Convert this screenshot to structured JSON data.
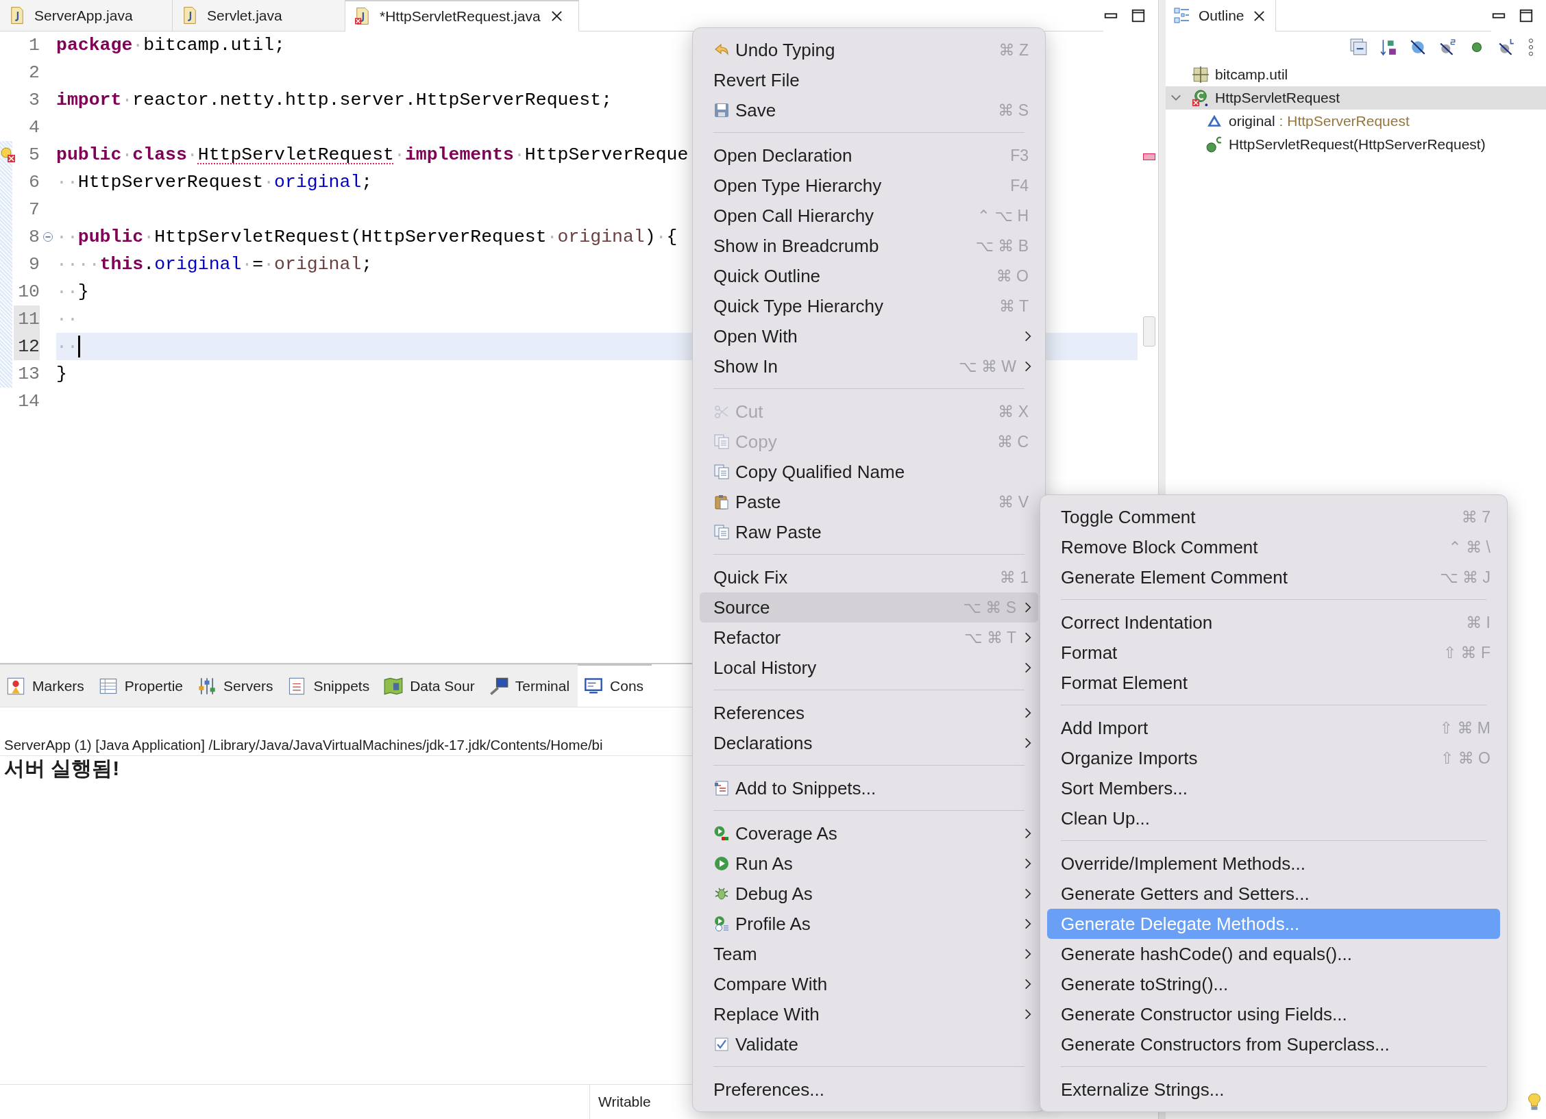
{
  "editor": {
    "tabs": [
      {
        "label": "ServerApp.java",
        "selected": false,
        "error": false
      },
      {
        "label": "Servlet.java",
        "selected": false,
        "error": false
      },
      {
        "label": "*HttpServletRequest.java",
        "selected": true,
        "error": true
      }
    ],
    "lines": [
      {
        "number": "1",
        "current": false,
        "changed": false,
        "problem": false,
        "fold": false,
        "tokens": [
          {
            "text": "package",
            "kind": "kw"
          },
          {
            "text": "·",
            "kind": "ws"
          },
          {
            "text": "bitcamp.util;",
            "kind": "plain"
          }
        ]
      },
      {
        "number": "2",
        "current": false,
        "changed": false,
        "problem": false,
        "fold": false
      },
      {
        "number": "3",
        "current": false,
        "changed": false,
        "problem": false,
        "fold": false,
        "tokens": [
          {
            "text": "import",
            "kind": "kw"
          },
          {
            "text": "·",
            "kind": "ws"
          },
          {
            "text": "reactor.netty.http.server.HttpServerRequest;",
            "kind": "plain"
          }
        ]
      },
      {
        "number": "4",
        "current": false,
        "changed": false,
        "problem": false,
        "fold": false
      },
      {
        "number": "5",
        "current": false,
        "changed": false,
        "problem": true,
        "fold": false,
        "tokens": [
          {
            "text": "public",
            "kind": "kw"
          },
          {
            "text": "·",
            "kind": "ws"
          },
          {
            "text": "class",
            "kind": "kw"
          },
          {
            "text": "·",
            "kind": "ws"
          },
          {
            "text": "HttpServletRequest",
            "kind": "error"
          },
          {
            "text": "·",
            "kind": "ws"
          },
          {
            "text": "implements",
            "kind": "kw"
          },
          {
            "text": "·",
            "kind": "ws"
          },
          {
            "text": "HttpServerReque",
            "kind": "plain"
          }
        ]
      },
      {
        "number": "6",
        "current": false,
        "changed": false,
        "problem": false,
        "fold": false,
        "tokens": [
          {
            "text": "··",
            "kind": "ws"
          },
          {
            "text": "HttpServerRequest",
            "kind": "plain"
          },
          {
            "text": "·",
            "kind": "ws"
          },
          {
            "text": "original",
            "kind": "field"
          },
          {
            "text": ";",
            "kind": "plain"
          }
        ]
      },
      {
        "number": "7",
        "current": false,
        "changed": false,
        "problem": false,
        "fold": false
      },
      {
        "number": "8",
        "current": false,
        "changed": false,
        "problem": false,
        "fold": true,
        "tokens": [
          {
            "text": "··",
            "kind": "ws"
          },
          {
            "text": "public",
            "kind": "kw"
          },
          {
            "text": "·",
            "kind": "ws"
          },
          {
            "text": "HttpServletRequest(HttpServerRequest",
            "kind": "plain"
          },
          {
            "text": "·",
            "kind": "ws"
          },
          {
            "text": "original",
            "kind": "param"
          },
          {
            "text": ")",
            "kind": "plain"
          },
          {
            "text": "·",
            "kind": "ws"
          },
          {
            "text": "{",
            "kind": "plain"
          }
        ]
      },
      {
        "number": "9",
        "current": false,
        "changed": false,
        "problem": false,
        "fold": false,
        "tokens": [
          {
            "text": "····",
            "kind": "ws"
          },
          {
            "text": "this",
            "kind": "kw"
          },
          {
            "text": ".",
            "kind": "plain"
          },
          {
            "text": "original",
            "kind": "field"
          },
          {
            "text": "·",
            "kind": "ws"
          },
          {
            "text": "=",
            "kind": "plain"
          },
          {
            "text": "·",
            "kind": "ws"
          },
          {
            "text": "original",
            "kind": "param"
          },
          {
            "text": ";",
            "kind": "plain"
          }
        ]
      },
      {
        "number": "10",
        "current": false,
        "changed": false,
        "problem": false,
        "fold": false,
        "tokens": [
          {
            "text": "··",
            "kind": "ws"
          },
          {
            "text": "}",
            "kind": "plain"
          }
        ]
      },
      {
        "number": "11",
        "current": false,
        "changed": true,
        "problem": false,
        "fold": false,
        "tokens": [
          {
            "text": "··",
            "kind": "ws"
          }
        ]
      },
      {
        "number": "12",
        "current": true,
        "changed": true,
        "problem": false,
        "fold": false,
        "tokens": [
          {
            "text": "··",
            "kind": "ws"
          }
        ]
      },
      {
        "number": "13",
        "current": false,
        "changed": false,
        "problem": false,
        "fold": false,
        "tokens": [
          {
            "text": "}",
            "kind": "plain"
          }
        ]
      },
      {
        "number": "14",
        "current": false,
        "changed": false,
        "problem": false,
        "fold": false
      }
    ]
  },
  "bottom_panel": {
    "tabs": [
      {
        "label": "Markers",
        "selected": false
      },
      {
        "label": "Propertie",
        "selected": false
      },
      {
        "label": "Servers",
        "selected": false
      },
      {
        "label": "Snippets",
        "selected": false
      },
      {
        "label": "Data Sour",
        "selected": false
      },
      {
        "label": "Terminal",
        "selected": false
      },
      {
        "label": "Cons",
        "selected": true
      }
    ],
    "console_header": "ServerApp (1) [Java Application] /Library/Java/JavaVirtualMachines/jdk-17.jdk/Contents/Home/bi",
    "output": [
      "서버 실행됨!"
    ]
  },
  "status_bar": {
    "mode": "Writable"
  },
  "outline": {
    "title": "Outline",
    "items": [
      {
        "label": "bitcamp.util",
        "kind": "package",
        "selected": false
      },
      {
        "label": "HttpServletRequest",
        "kind": "class",
        "selected": true,
        "expanded": true,
        "children": [
          {
            "label": "original",
            "type": ": HttpServerRequest",
            "kind": "field",
            "selected": false
          },
          {
            "label": "HttpServletRequest(HttpServerRequest)",
            "kind": "constructor",
            "selected": false
          }
        ]
      }
    ]
  },
  "context_menu": {
    "groups": [
      {
        "items": [
          {
            "label": "Undo Typing",
            "shortcut": "⌘ Z",
            "submenu": false,
            "disabled": false,
            "selected": false
          },
          {
            "label": "Revert File",
            "submenu": false,
            "disabled": false,
            "selected": false
          },
          {
            "label": "Save",
            "shortcut": "⌘ S",
            "submenu": false,
            "disabled": false,
            "selected": false
          }
        ]
      },
      {
        "items": [
          {
            "label": "Open Declaration",
            "shortcut": "F3",
            "submenu": false,
            "disabled": false,
            "selected": false
          },
          {
            "label": "Open Type Hierarchy",
            "shortcut": "F4",
            "submenu": false,
            "disabled": false,
            "selected": false
          },
          {
            "label": "Open Call Hierarchy",
            "shortcut": "⌃ ⌥ H",
            "submenu": false,
            "disabled": false,
            "selected": false
          },
          {
            "label": "Show in Breadcrumb",
            "shortcut": "⌥ ⌘ B",
            "submenu": false,
            "disabled": false,
            "selected": false
          },
          {
            "label": "Quick Outline",
            "shortcut": "⌘ O",
            "submenu": false,
            "disabled": false,
            "selected": false
          },
          {
            "label": "Quick Type Hierarchy",
            "shortcut": "⌘ T",
            "submenu": false,
            "disabled": false,
            "selected": false
          },
          {
            "label": "Open With",
            "submenu": true,
            "disabled": false,
            "selected": false
          },
          {
            "label": "Show In",
            "shortcut": "⌥ ⌘ W",
            "submenu": true,
            "disabled": false,
            "selected": false
          }
        ]
      },
      {
        "items": [
          {
            "label": "Cut",
            "shortcut": "⌘ X",
            "submenu": false,
            "disabled": true,
            "selected": false
          },
          {
            "label": "Copy",
            "shortcut": "⌘ C",
            "submenu": false,
            "disabled": true,
            "selected": false
          },
          {
            "label": "Copy Qualified Name",
            "submenu": false,
            "disabled": false,
            "selected": false
          },
          {
            "label": "Paste",
            "shortcut": "⌘ V",
            "submenu": false,
            "disabled": false,
            "selected": false
          },
          {
            "label": "Raw Paste",
            "submenu": false,
            "disabled": false,
            "selected": false
          }
        ]
      },
      {
        "items": [
          {
            "label": "Quick Fix",
            "shortcut": "⌘ 1",
            "submenu": false,
            "disabled": false,
            "selected": false
          },
          {
            "label": "Source",
            "shortcut": "⌥ ⌘ S",
            "submenu": true,
            "disabled": false,
            "selected": true
          },
          {
            "label": "Refactor",
            "shortcut": "⌥ ⌘ T",
            "submenu": true,
            "disabled": false,
            "selected": false
          },
          {
            "label": "Local History",
            "submenu": true,
            "disabled": false,
            "selected": false
          }
        ]
      },
      {
        "items": [
          {
            "label": "References",
            "submenu": true,
            "disabled": false,
            "selected": false
          },
          {
            "label": "Declarations",
            "submenu": true,
            "disabled": false,
            "selected": false
          }
        ]
      },
      {
        "items": [
          {
            "label": "Add to Snippets...",
            "submenu": false,
            "disabled": false,
            "selected": false
          }
        ]
      },
      {
        "items": [
          {
            "label": "Coverage As",
            "submenu": true,
            "disabled": false,
            "selected": false
          },
          {
            "label": "Run As",
            "submenu": true,
            "disabled": false,
            "selected": false
          },
          {
            "label": "Debug As",
            "submenu": true,
            "disabled": false,
            "selected": false
          },
          {
            "label": "Profile As",
            "submenu": true,
            "disabled": false,
            "selected": false
          },
          {
            "label": "Team",
            "submenu": true,
            "disabled": false,
            "selected": false
          },
          {
            "label": "Compare With",
            "submenu": true,
            "disabled": false,
            "selected": false
          },
          {
            "label": "Replace With",
            "submenu": true,
            "disabled": false,
            "selected": false
          },
          {
            "label": "Validate",
            "submenu": false,
            "disabled": false,
            "selected": false
          }
        ]
      },
      {
        "items": [
          {
            "label": "Preferences...",
            "submenu": false,
            "disabled": false,
            "selected": false
          }
        ]
      }
    ]
  },
  "source_submenu": {
    "groups": [
      {
        "items": [
          {
            "label": "Toggle Comment",
            "shortcut": "⌘ 7",
            "selected": false
          },
          {
            "label": "Remove Block Comment",
            "shortcut": "⌃ ⌘ \\",
            "selected": false
          },
          {
            "label": "Generate Element Comment",
            "shortcut": "⌥ ⌘ J",
            "selected": false
          }
        ]
      },
      {
        "items": [
          {
            "label": "Correct Indentation",
            "shortcut": "⌘ I",
            "selected": false
          },
          {
            "label": "Format",
            "shortcut": "⇧ ⌘ F",
            "selected": false
          },
          {
            "label": "Format Element",
            "selected": false
          }
        ]
      },
      {
        "items": [
          {
            "label": "Add Import",
            "shortcut": "⇧ ⌘ M",
            "selected": false
          },
          {
            "label": "Organize Imports",
            "shortcut": "⇧ ⌘ O",
            "selected": false
          },
          {
            "label": "Sort Members...",
            "selected": false
          },
          {
            "label": "Clean Up...",
            "selected": false
          }
        ]
      },
      {
        "items": [
          {
            "label": "Override/Implement Methods...",
            "selected": false
          },
          {
            "label": "Generate Getters and Setters...",
            "selected": false
          },
          {
            "label": "Generate Delegate Methods...",
            "selected": true
          },
          {
            "label": "Generate hashCode() and equals()...",
            "selected": false
          },
          {
            "label": "Generate toString()...",
            "selected": false
          },
          {
            "label": "Generate Constructor using Fields...",
            "selected": false
          },
          {
            "label": "Generate Constructors from Superclass...",
            "selected": false
          }
        ]
      },
      {
        "items": [
          {
            "label": "Externalize Strings...",
            "selected": false
          }
        ]
      }
    ]
  }
}
